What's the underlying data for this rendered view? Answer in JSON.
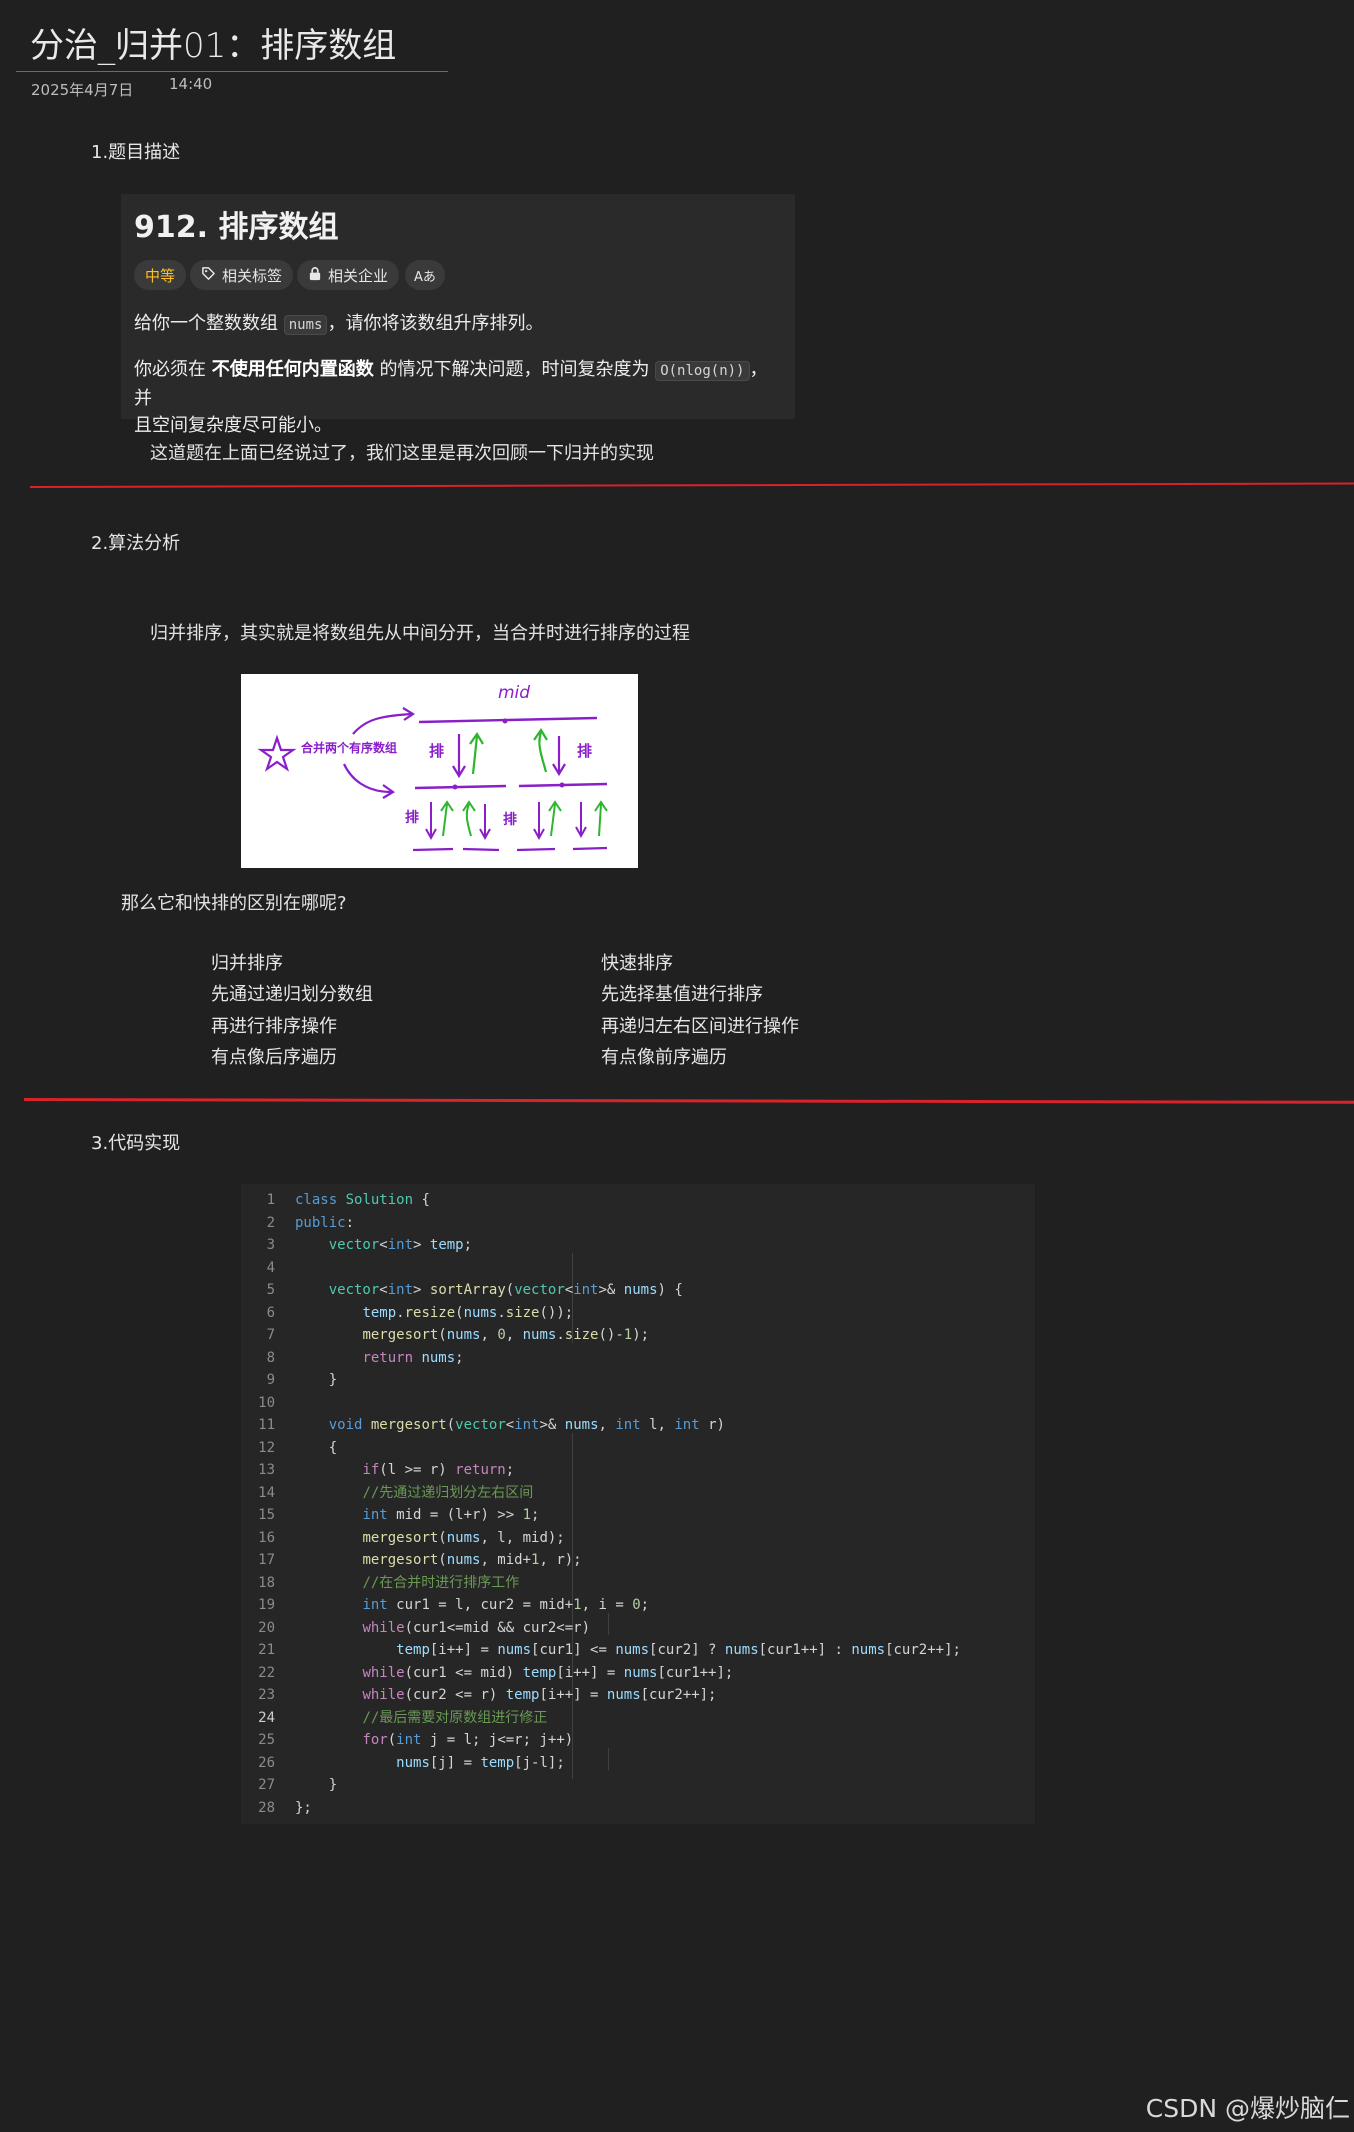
{
  "header": {
    "title": "分治_归并01：排序数组",
    "date": "2025年4月7日",
    "time": "14:40"
  },
  "sections": {
    "s1": "1.题目描述",
    "s2": "2.算法分析",
    "s3": "3.代码实现"
  },
  "problem": {
    "title": "912. 排序数组",
    "tags": {
      "difficulty": "中等",
      "related_tags": "相关标签",
      "related_companies": "相关企业",
      "translate": "Aあ"
    },
    "p1_before": "给你一个整数数组",
    "p1_code": "nums",
    "p1_after": "，请你将该数组升序排列。",
    "p2_before": "你必须在",
    "p2_bold": "不使用任何内置函数",
    "p2_mid": "的情况下解决问题，时间复杂度为",
    "p2_code": "O(nlog(n))",
    "p2_after": "，并",
    "p2_line2": "且空间复杂度尽可能小。"
  },
  "notes": {
    "after_problem": "这道题在上面已经说过了，我们这里是再次回顾一下归并的实现",
    "analysis": "归并排序，其实就是将数组先从中间分开，当合并时进行排序的过程",
    "question": "那么它和快排的区别在哪呢?"
  },
  "diagram": {
    "mid_label": "mid",
    "merge_label": "合并两个有序数组",
    "sort_mark": "排"
  },
  "comparison": {
    "left": [
      "归并排序",
      "先通过递归划分数组",
      "再进行排序操作",
      "有点像后序遍历"
    ],
    "right": [
      "快速排序",
      "先选择基值进行排序",
      "再递归左右区间进行操作",
      "有点像前序遍历"
    ]
  },
  "code": {
    "line_numbers": [
      "1",
      "2",
      "3",
      "4",
      "5",
      "6",
      "7",
      "8",
      "9",
      "10",
      "11",
      "12",
      "13",
      "14",
      "15",
      "16",
      "17",
      "18",
      "19",
      "20",
      "21",
      "22",
      "23",
      "24",
      "25",
      "26",
      "27",
      "28"
    ],
    "active_line": "24",
    "lines": [
      "class Solution {",
      "public:",
      "    vector<int> temp;",
      "",
      "    vector<int> sortArray(vector<int>& nums) {",
      "        temp.resize(nums.size());",
      "        mergesort(nums, 0, nums.size()-1);",
      "        return nums;",
      "    }",
      "",
      "    void mergesort(vector<int>& nums, int l, int r)",
      "    {",
      "        if(l >= r) return;",
      "        //先通过递归划分左右区间",
      "        int mid = (l+r) >> 1;",
      "        mergesort(nums, l, mid);",
      "        mergesort(nums, mid+1, r);",
      "        //在合并时进行排序工作",
      "        int cur1 = l, cur2 = mid+1, i = 0;",
      "        while(cur1<=mid && cur2<=r)",
      "            temp[i++] = nums[cur1] <= nums[cur2] ? nums[cur1++] : nums[cur2++];",
      "        while(cur1 <= mid) temp[i++] = nums[cur1++];",
      "        while(cur2 <= r) temp[i++] = nums[cur2++];",
      "        //最后需要对原数组进行修正",
      "        for(int j = l; j<=r; j++)",
      "            nums[j] = temp[j-l];",
      "    }",
      "};"
    ]
  },
  "watermark": "CSDN @爆炒脑仁",
  "colors": {
    "background": "#202020",
    "divider_red": "#d8232a",
    "difficulty_medium": "#ffc01e",
    "diagram_purple": "#8a1fc9",
    "diagram_green": "#2db62d"
  }
}
